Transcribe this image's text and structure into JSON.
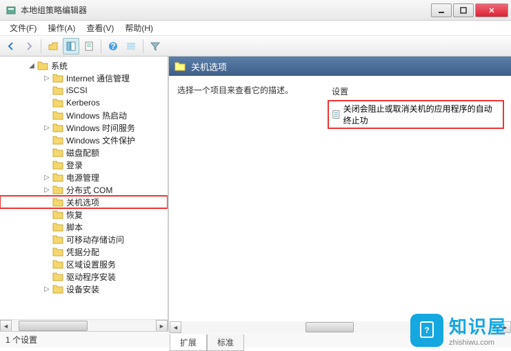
{
  "window": {
    "title": "本地组策略编辑器",
    "min_tooltip": "最小化",
    "max_tooltip": "最大化",
    "close_tooltip": "关闭"
  },
  "menu": {
    "file": "文件(F)",
    "action": "操作(A)",
    "view": "查看(V)",
    "help": "帮助(H)"
  },
  "toolbar": {
    "back": "后退",
    "forward": "前进",
    "up": "上一级",
    "show_tree": "显示/隐藏控制台树",
    "properties": "属性",
    "help": "帮助",
    "details": "详细信息",
    "filter": "筛选"
  },
  "tree": {
    "root": "系统",
    "items": [
      {
        "label": "Internet 通信管理",
        "expandable": true
      },
      {
        "label": "iSCSI",
        "expandable": false
      },
      {
        "label": "Kerberos",
        "expandable": false
      },
      {
        "label": "Windows 热启动",
        "expandable": false
      },
      {
        "label": "Windows 时间服务",
        "expandable": true
      },
      {
        "label": "Windows 文件保护",
        "expandable": false
      },
      {
        "label": "磁盘配额",
        "expandable": false
      },
      {
        "label": "登录",
        "expandable": false
      },
      {
        "label": "电源管理",
        "expandable": true
      },
      {
        "label": "分布式 COM",
        "expandable": true
      },
      {
        "label": "关机选项",
        "expandable": false,
        "highlighted": true
      },
      {
        "label": "恢复",
        "expandable": false
      },
      {
        "label": "脚本",
        "expandable": false
      },
      {
        "label": "可移动存储访问",
        "expandable": false
      },
      {
        "label": "凭据分配",
        "expandable": false
      },
      {
        "label": "区域设置服务",
        "expandable": false
      },
      {
        "label": "驱动程序安装",
        "expandable": false
      },
      {
        "label": "设备安装",
        "expandable": true
      }
    ]
  },
  "detail": {
    "title": "关机选项",
    "description": "选择一个项目来查看它的描述。",
    "column_header": "设置",
    "items": [
      {
        "label": "关闭会阻止或取消关机的应用程序的自动终止功",
        "highlighted": true
      }
    ]
  },
  "tabs": {
    "extended": "扩展",
    "standard": "标准"
  },
  "status": {
    "text": "1 个设置"
  },
  "watermark": {
    "main": "知识屋",
    "sub": "zhishiwu.com"
  }
}
